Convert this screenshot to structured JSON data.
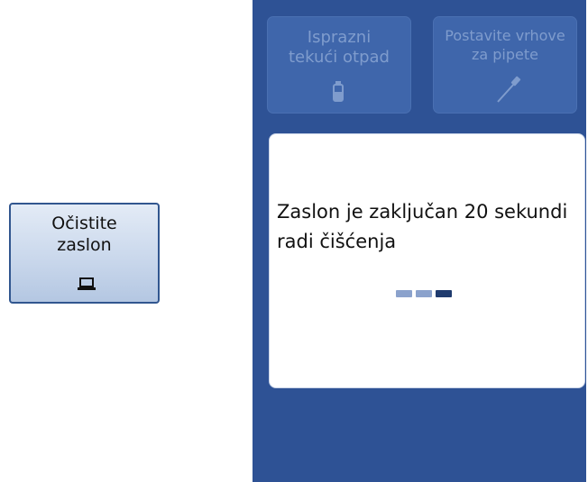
{
  "left_button": {
    "label": "Očistite\nzaslon",
    "icon": "laptop-icon"
  },
  "tiles": [
    {
      "label": "Isprazni\ntekući otpad",
      "icon": "waste-bottle-icon"
    },
    {
      "label": "Postavite vrhove\nza pipete",
      "icon": "pipette-icon"
    }
  ],
  "dialog": {
    "message": "Zaslon je zaključan 20 sekundi radi čišćenja",
    "progress": {
      "total_steps": 3,
      "active_step": 3
    }
  },
  "colors": {
    "panel_bg": "#2e5295",
    "tile_bg": "#3f66ab",
    "tile_text": "#7f9ccd",
    "dot_inactive": "#8ba2cc",
    "dot_active": "#1f3b6e"
  }
}
